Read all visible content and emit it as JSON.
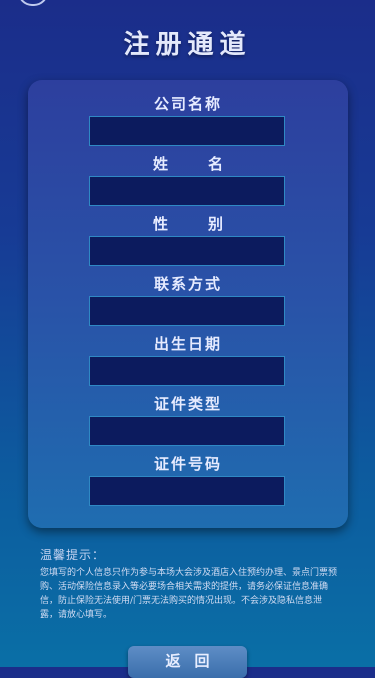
{
  "header": {
    "title": "注册通道"
  },
  "form": {
    "fields": [
      {
        "label": "公司名称",
        "value": ""
      },
      {
        "label": "姓名",
        "value": ""
      },
      {
        "label": "性别",
        "value": ""
      },
      {
        "label": "联系方式",
        "value": ""
      },
      {
        "label": "出生日期",
        "value": ""
      },
      {
        "label": "证件类型",
        "value": ""
      },
      {
        "label": "证件号码",
        "value": ""
      }
    ]
  },
  "notice": {
    "title": "温馨提示：",
    "text": "您填写的个人信息只作为参与本场大会涉及酒店入住预约办理、景点门票预购、活动保险信息录入等必要场合相关需求的提供，请务必保证信息准确信，防止保险无法使用/门票无法购买的情况出现。不会涉及隐私信息泄露，请放心填写。"
  },
  "footer": {
    "back_label": "返回"
  }
}
